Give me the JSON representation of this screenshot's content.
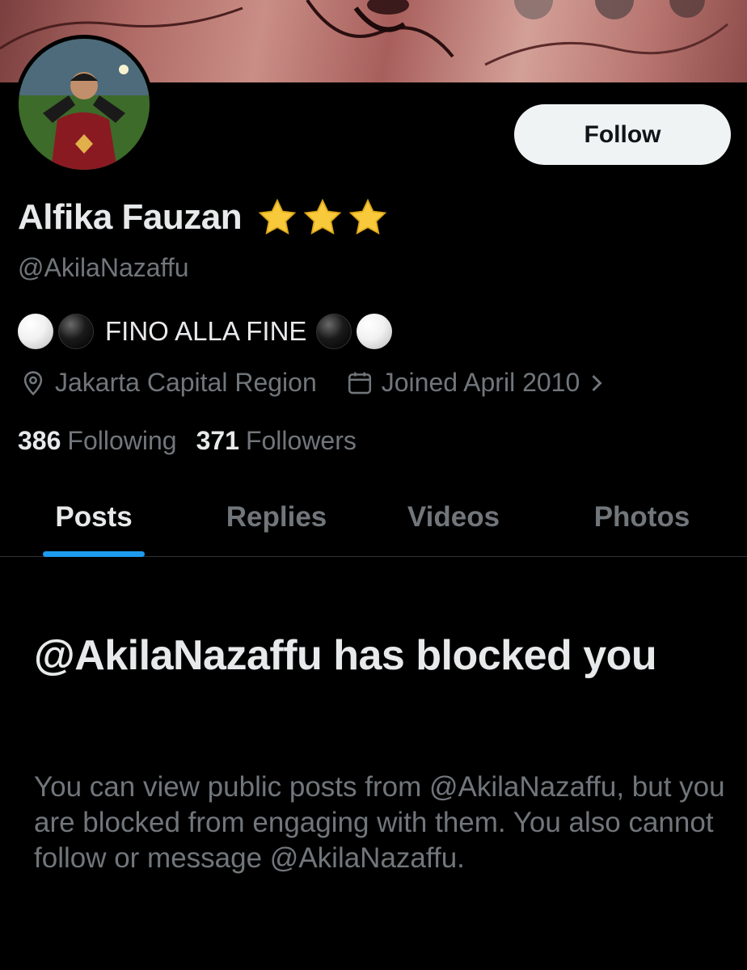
{
  "profile": {
    "display_name": "Alfika Fauzan",
    "handle": "@AkilaNazaffu",
    "bio_text": "FINO ALLA FINE",
    "location": "Jakarta Capital Region",
    "joined": "Joined April 2010"
  },
  "actions": {
    "follow_label": "Follow"
  },
  "stats": {
    "following_count": "386",
    "following_label": "Following",
    "followers_count": "371",
    "followers_label": "Followers"
  },
  "tabs": [
    {
      "label": "Posts",
      "active": true
    },
    {
      "label": "Replies",
      "active": false
    },
    {
      "label": "Videos",
      "active": false
    },
    {
      "label": "Photos",
      "active": false
    }
  ],
  "blocked": {
    "title": "@AkilaNazaffu has blocked you",
    "message": "You can view public posts from @AkilaNazaffu, but you are blocked from engaging with them. You also cannot follow or message @AkilaNazaffu."
  },
  "icons": {
    "verified_stars": "star-icon",
    "location": "location-pin-icon",
    "calendar": "calendar-icon",
    "chevron": "chevron-right-icon"
  },
  "colors": {
    "background": "#000000",
    "primary_text": "#e7e9ea",
    "secondary_text": "#71767b",
    "accent": "#1d9bf0",
    "button_bg": "#eff3f4"
  }
}
